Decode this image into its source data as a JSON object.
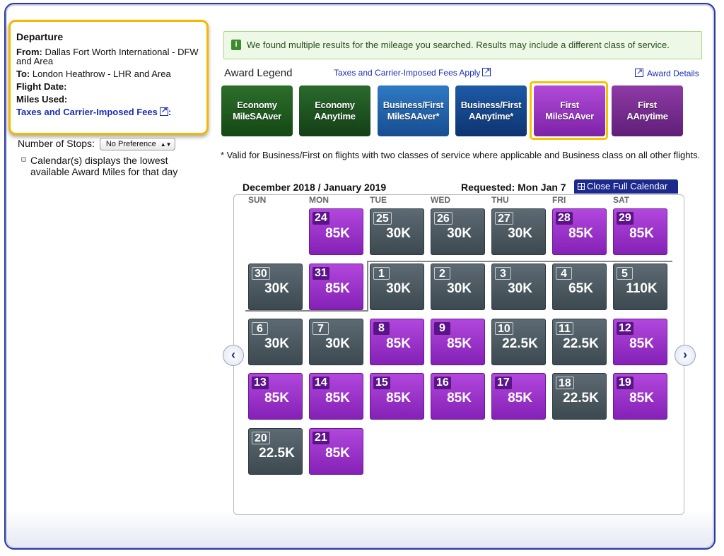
{
  "departure": {
    "title": "Departure",
    "from_label": "From:",
    "from_value": "Dallas Fort Worth International - DFW and Area",
    "to_label": "To:",
    "to_value": "London Heathrow - LHR and Area",
    "flight_date_label": "Flight Date:",
    "miles_used_label": "Miles Used:",
    "fees_label": "Taxes and Carrier-Imposed Fees",
    "fees_colon": ":"
  },
  "filters": {
    "stops_label": "Number of Stops:",
    "stops_value": "No Preference",
    "calendar_note": "Calendar(s) displays the lowest available Award Miles for that day"
  },
  "info_message": "We found multiple results for the mileage you searched. Results may include a different class of service.",
  "legend": {
    "title": "Award Legend",
    "fees_link": "Taxes and Carrier-Imposed Fees Apply",
    "award_details": "Award Details",
    "buttons": [
      {
        "line1": "Economy",
        "line2": "MileSAAver"
      },
      {
        "line1": "Economy",
        "line2": "AAnytime"
      },
      {
        "line1": "Business/First",
        "line2": "MileSAAver*"
      },
      {
        "line1": "Business/First",
        "line2": "AAnytime*"
      },
      {
        "line1": "First",
        "line2": "MileSAAver"
      },
      {
        "line1": "First",
        "line2": "AAnytime"
      }
    ],
    "selected_index": 4
  },
  "footnote": "* Valid for Business/First on flights with two classes of service where applicable and Business class on all other flights.",
  "calendar": {
    "heading": "December 2018 / January 2019",
    "requested": "Requested: Mon Jan 7",
    "close_label": "Close Full Calendar",
    "days_of_week": [
      "SUN",
      "MON",
      "TUE",
      "WED",
      "THU",
      "FRI",
      "SAT"
    ],
    "weeks": [
      [
        null,
        {
          "day": "24",
          "miles": "85K",
          "type": "purple"
        },
        {
          "day": "25",
          "miles": "30K",
          "type": "gray"
        },
        {
          "day": "26",
          "miles": "30K",
          "type": "gray"
        },
        {
          "day": "27",
          "miles": "30K",
          "type": "gray"
        },
        {
          "day": "28",
          "miles": "85K",
          "type": "purple"
        },
        {
          "day": "29",
          "miles": "85K",
          "type": "purple"
        }
      ],
      [
        {
          "day": "30",
          "miles": "30K",
          "type": "gray"
        },
        {
          "day": "31",
          "miles": "85K",
          "type": "purple"
        },
        {
          "day": "1",
          "miles": "30K",
          "type": "gray"
        },
        {
          "day": "2",
          "miles": "30K",
          "type": "gray"
        },
        {
          "day": "3",
          "miles": "30K",
          "type": "gray"
        },
        {
          "day": "4",
          "miles": "65K",
          "type": "gray"
        },
        {
          "day": "5",
          "miles": "110K",
          "type": "gray"
        }
      ],
      [
        {
          "day": "6",
          "miles": "30K",
          "type": "gray"
        },
        {
          "day": "7",
          "miles": "30K",
          "type": "gray"
        },
        {
          "day": "8",
          "miles": "85K",
          "type": "purple"
        },
        {
          "day": "9",
          "miles": "85K",
          "type": "purple"
        },
        {
          "day": "10",
          "miles": "22.5K",
          "type": "gray"
        },
        {
          "day": "11",
          "miles": "22.5K",
          "type": "gray"
        },
        {
          "day": "12",
          "miles": "85K",
          "type": "purple"
        }
      ],
      [
        {
          "day": "13",
          "miles": "85K",
          "type": "purple"
        },
        {
          "day": "14",
          "miles": "85K",
          "type": "purple"
        },
        {
          "day": "15",
          "miles": "85K",
          "type": "purple"
        },
        {
          "day": "16",
          "miles": "85K",
          "type": "purple"
        },
        {
          "day": "17",
          "miles": "85K",
          "type": "purple"
        },
        {
          "day": "18",
          "miles": "22.5K",
          "type": "gray"
        },
        {
          "day": "19",
          "miles": "85K",
          "type": "purple"
        }
      ],
      [
        {
          "day": "20",
          "miles": "22.5K",
          "type": "gray"
        },
        {
          "day": "21",
          "miles": "85K",
          "type": "purple"
        },
        null,
        null,
        null,
        null,
        null
      ]
    ],
    "prev_icon": "chevron-left-icon",
    "next_icon": "chevron-right-icon"
  }
}
